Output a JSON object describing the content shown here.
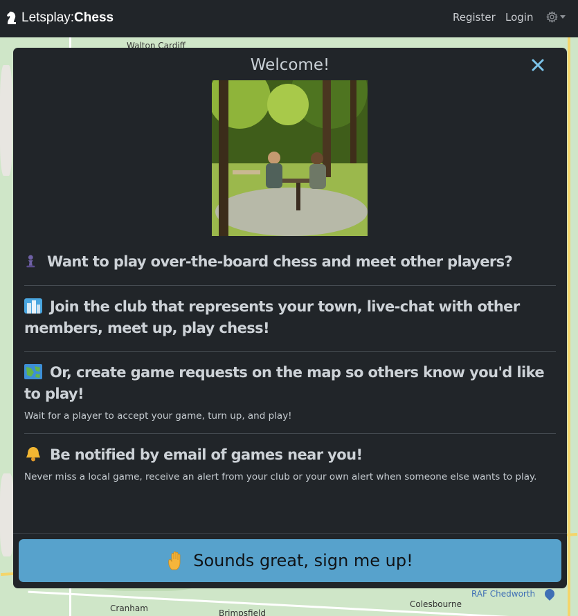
{
  "navbar": {
    "brand_prefix": "Letsplay:",
    "brand_name": "Chess",
    "register": "Register",
    "login": "Login",
    "settings_icon": "gear-icon"
  },
  "map": {
    "labels": [
      "Walton Cardiff",
      "RAF Chedworth",
      "Colesbourne",
      "Cranham",
      "Brimpsfield"
    ]
  },
  "modal": {
    "title": "Welcome!",
    "close_icon": "close-icon",
    "sections": [
      {
        "icon": "pawn-icon",
        "heading": "Want to play over-the-board chess and meet other players?",
        "text": ""
      },
      {
        "icon": "city-icon",
        "heading": "Join the club that represents your town, live-chat with other members, meet up, play chess!",
        "text": ""
      },
      {
        "icon": "map-icon",
        "heading": "Or, create game requests on the map so others know you'd like to play!",
        "text": "Wait for a player to accept your game, turn up, and play!"
      },
      {
        "icon": "bell-icon",
        "heading": "Be notified by email of games near you!",
        "text": "Never miss a local game, receive an alert from your club or your own alert when someone else wants to play."
      }
    ],
    "cta_label": "Sounds great, sign me up!",
    "cta_icon": "raised-hand-icon"
  },
  "colors": {
    "navbar_bg": "#212529",
    "modal_bg": "#212529",
    "cta_bg": "#57a2cc",
    "close": "#7cc4ea"
  }
}
